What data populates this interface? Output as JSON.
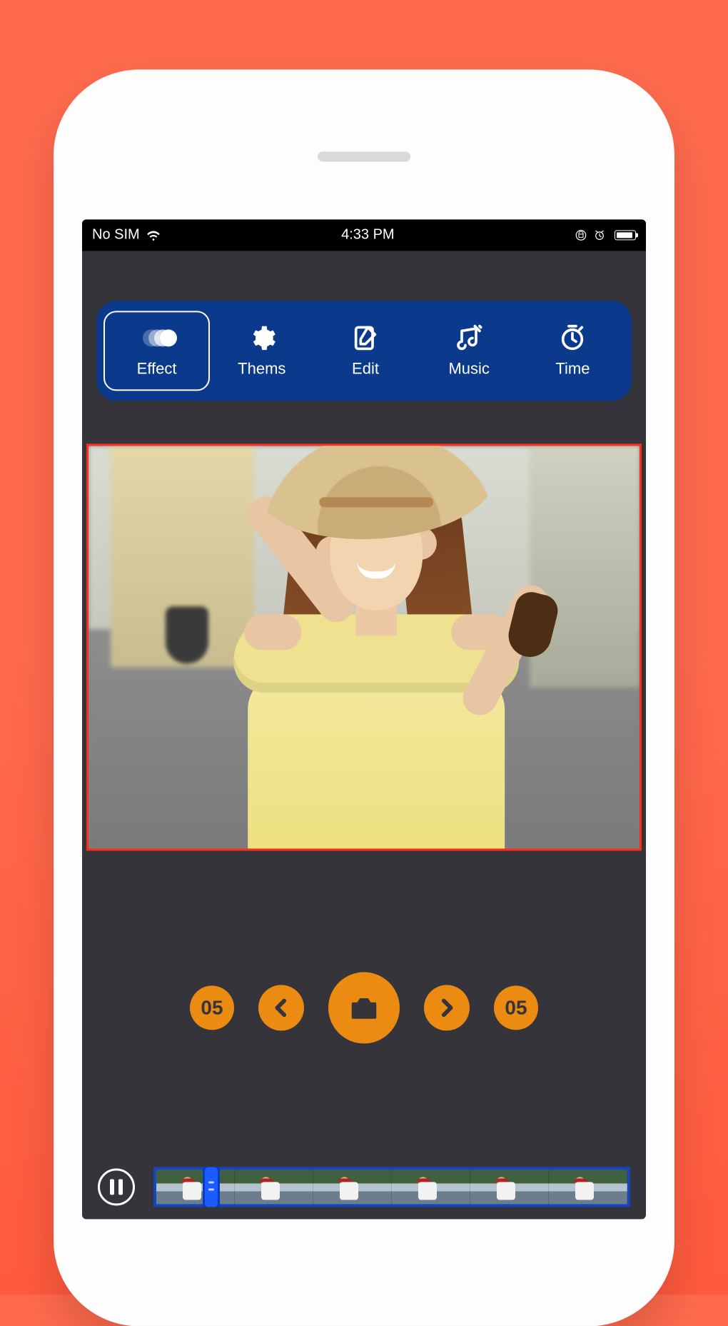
{
  "status": {
    "carrier": "No SIM",
    "time": "4:33 PM"
  },
  "toolbar": {
    "items": [
      {
        "label": "Effect",
        "icon": "effect-icon",
        "active": true
      },
      {
        "label": "Thems",
        "icon": "gear-icon",
        "active": false
      },
      {
        "label": "Edit",
        "icon": "edit-icon",
        "active": false
      },
      {
        "label": "Music",
        "icon": "music-icon",
        "active": false
      },
      {
        "label": "Time",
        "icon": "timer-icon",
        "active": false
      }
    ]
  },
  "preview": {
    "description": "Woman in yellow dress with straw hat holding sunglasses on a European street"
  },
  "controls": {
    "left_count": "05",
    "right_count": "05"
  },
  "timeline": {
    "frame_count": 6,
    "playhead_index": 0
  },
  "colors": {
    "accent_orange": "#ec8b12",
    "toolbar_blue": "#0b3a8c",
    "preview_border": "#ff2a1a",
    "bg_coral": "#ff6a4d"
  }
}
